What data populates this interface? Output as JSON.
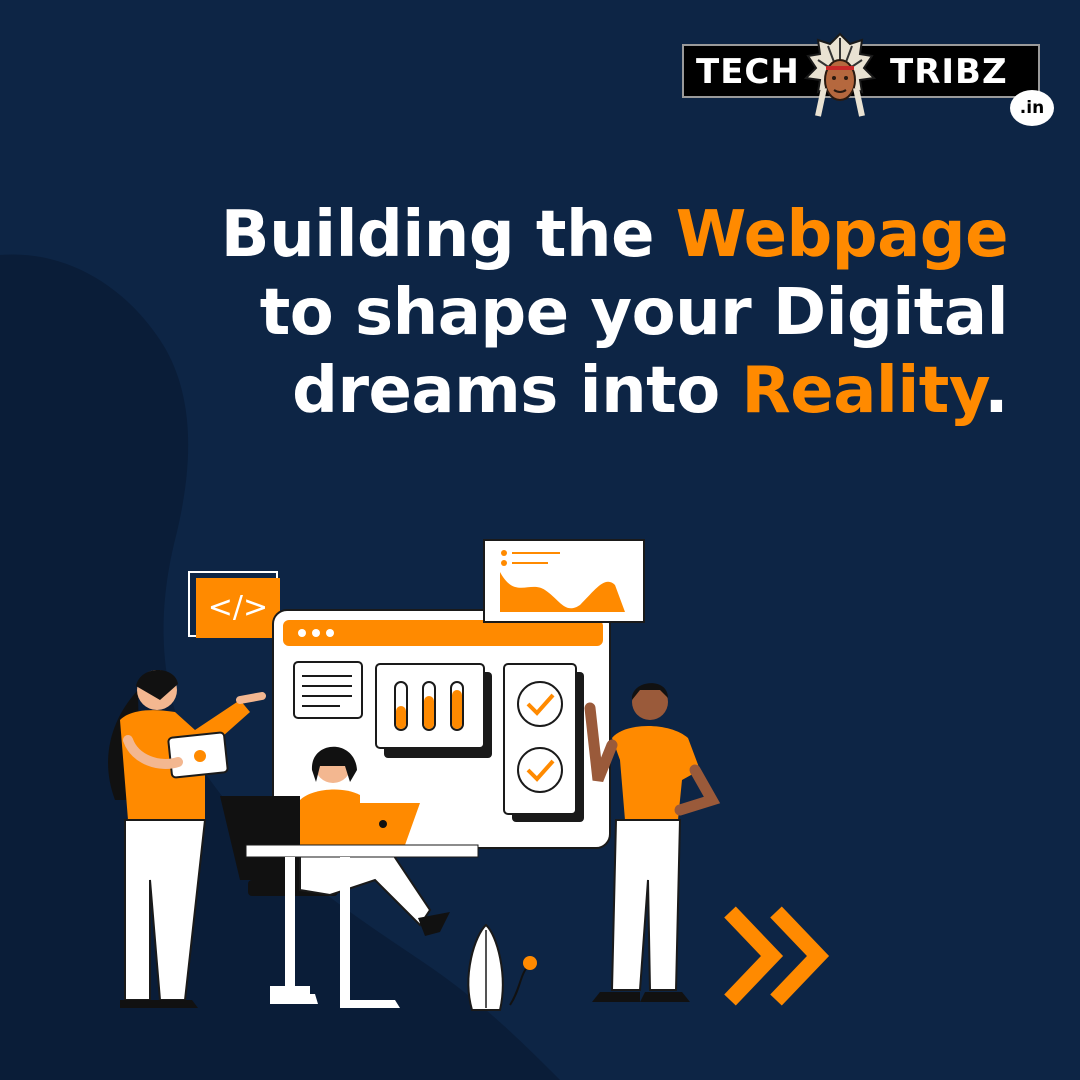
{
  "colors": {
    "background": "#0d2545",
    "blob": "#0a1d38",
    "accent": "#ff8a00",
    "text": "#ffffff"
  },
  "logo": {
    "left_word": "TECH",
    "right_word": "TRIBZ",
    "tld": ".in",
    "mascot_icon": "native-chief-headdress-icon"
  },
  "headline": {
    "line1_prefix": "Building the ",
    "line1_highlight": "Webpage",
    "line2": "to shape your Digital",
    "line3_prefix": "dreams into ",
    "line3_highlight": "Reality",
    "line3_suffix": "."
  },
  "illustration": {
    "code_tag": "</>",
    "icons": [
      "code-icon",
      "browser-window-icon",
      "area-chart-icon",
      "checkmark-icon",
      "double-chevron-right-icon"
    ]
  }
}
